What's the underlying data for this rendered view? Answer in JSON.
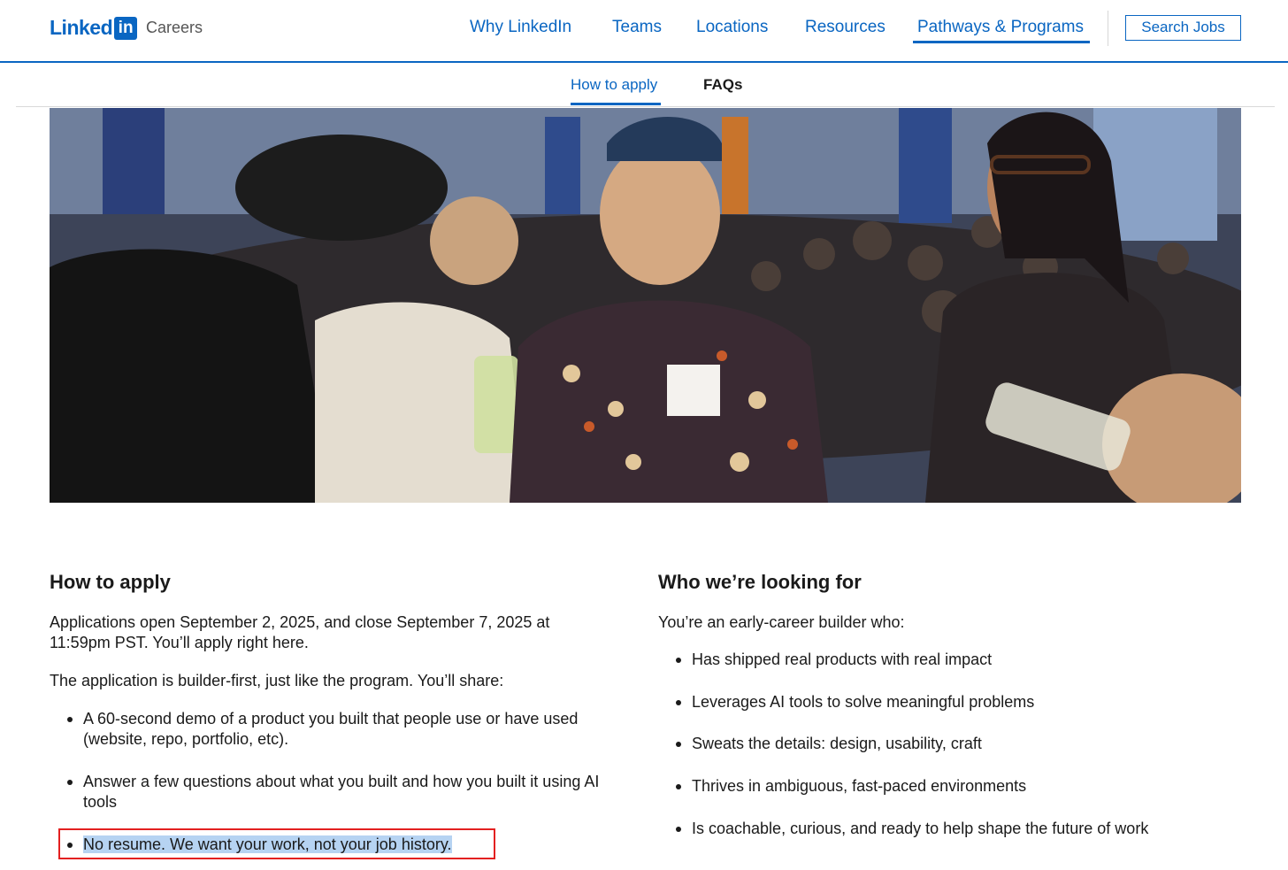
{
  "header": {
    "logo_text": "Linked",
    "logo_box": "in",
    "section": "Careers",
    "nav": [
      "Why LinkedIn",
      "Teams",
      "Locations",
      "Resources",
      "Pathways & Programs"
    ],
    "search_button": "Search Jobs"
  },
  "subnav": {
    "tabs": [
      "How to apply",
      "FAQs"
    ]
  },
  "how_to_apply": {
    "heading": "How to apply",
    "intro": "Applications open September 2, 2025, and close September 7, 2025 at 11:59pm PST. You’ll apply right here.",
    "lead": "The application is builder-first, just like the program. You’ll share:",
    "bullets": [
      "A 60-second demo of a product you built that people use or have used (website, repo, portfolio, etc).",
      "Answer a few questions about what you built and how you built it using AI tools",
      "No resume. We want your work, not your job history."
    ]
  },
  "looking_for": {
    "heading": "Who we’re looking for",
    "lead": "You’re an early-career builder who:",
    "bullets": [
      "Has shipped real products with real impact",
      "Leverages AI tools to solve meaningful problems",
      "Sweats the details: design, usability, craft",
      "Thrives in ambiguous, fast-paced environments",
      "Is coachable, curious, and ready to help shape the future of work"
    ]
  },
  "colors": {
    "brand": "#0a66c2",
    "highlight_box": "#e32020",
    "selection": "#b6d3f2"
  }
}
